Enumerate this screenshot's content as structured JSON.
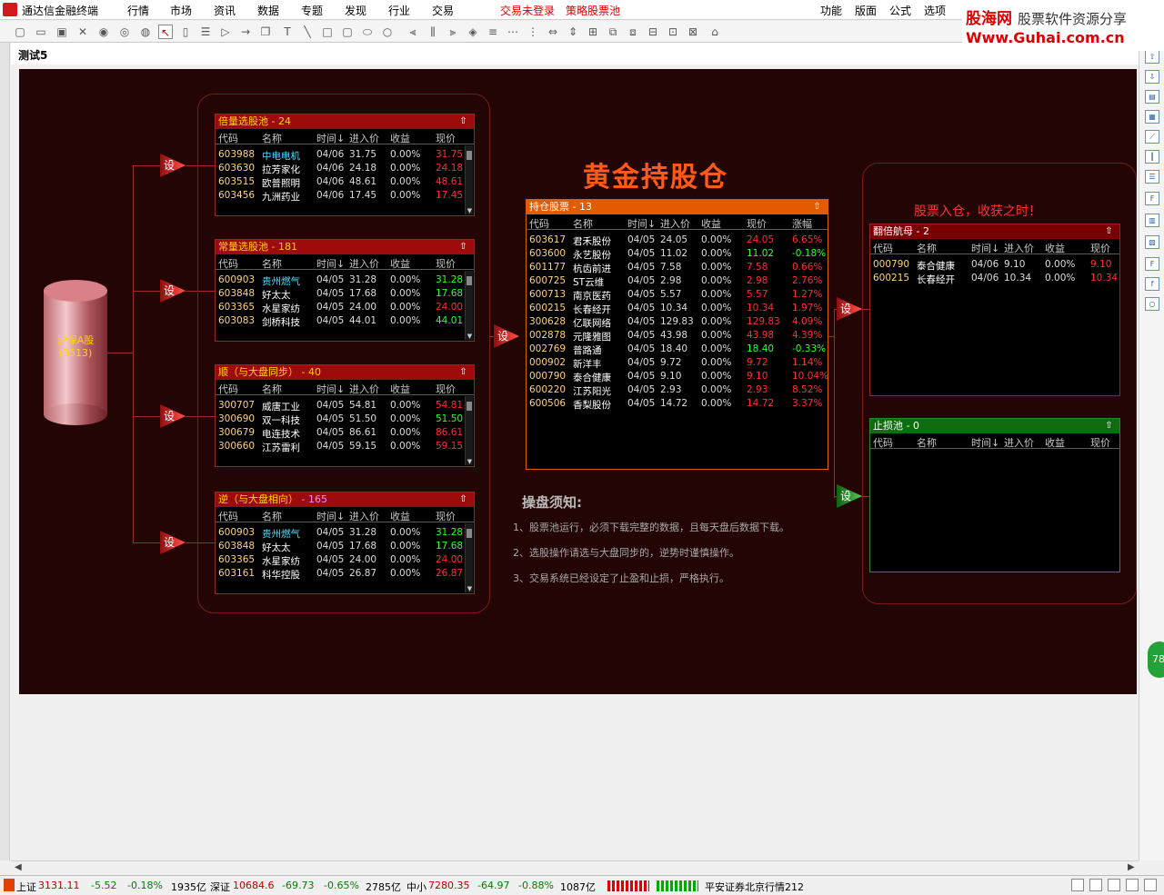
{
  "app": {
    "title": "通达信金融终端"
  },
  "menu": {
    "items": [
      "行情",
      "市场",
      "资讯",
      "数据",
      "专题",
      "发现",
      "行业",
      "交易"
    ],
    "login": "交易未登录",
    "strategy": "策略股票池",
    "right_items": [
      "功能",
      "版面",
      "公式",
      "选项"
    ]
  },
  "watermark": {
    "line1_brand": "股海网",
    "line1_tag": "股票软件资源分享",
    "line2": "Www.Guhai.com.cn"
  },
  "doc": {
    "title": "测试5"
  },
  "source": {
    "label": "沪深A股",
    "count": "(3513)"
  },
  "set_label": "设",
  "pools": [
    {
      "title": "倍量选股池",
      "count": "- 24",
      "headers": [
        "代码",
        "名称",
        "时间↓",
        "进入价",
        "收益",
        "现价"
      ],
      "rows": [
        {
          "code": "603988",
          "name": "中电电机",
          "time": "04/06",
          "entry": "31.75",
          "ret": "0.00%",
          "price": "31.75",
          "dir": "up",
          "cyan": true
        },
        {
          "code": "603630",
          "name": "拉芳家化",
          "time": "04/06",
          "entry": "24.18",
          "ret": "0.00%",
          "price": "24.18",
          "dir": "up",
          "cyan": false
        },
        {
          "code": "603515",
          "name": "欧普照明",
          "time": "04/06",
          "entry": "48.61",
          "ret": "0.00%",
          "price": "48.61",
          "dir": "up",
          "cyan": false
        },
        {
          "code": "603456",
          "name": "九洲药业",
          "time": "04/06",
          "entry": "17.45",
          "ret": "0.00%",
          "price": "17.45",
          "dir": "up",
          "cyan": false
        }
      ]
    },
    {
      "title": "常量选股池",
      "count": "- 181",
      "headers": [
        "代码",
        "名称",
        "时间↓",
        "进入价",
        "收益",
        "现价"
      ],
      "rows": [
        {
          "code": "600903",
          "name": "贵州燃气",
          "time": "04/05",
          "entry": "31.28",
          "ret": "0.00%",
          "price": "31.28",
          "dir": "dn",
          "cyan": true
        },
        {
          "code": "603848",
          "name": "好太太",
          "time": "04/05",
          "entry": "17.68",
          "ret": "0.00%",
          "price": "17.68",
          "dir": "dn",
          "cyan": false
        },
        {
          "code": "603365",
          "name": "水星家纺",
          "time": "04/05",
          "entry": "24.00",
          "ret": "0.00%",
          "price": "24.00",
          "dir": "up",
          "cyan": false
        },
        {
          "code": "603083",
          "name": "剑桥科技",
          "time": "04/05",
          "entry": "44.01",
          "ret": "0.00%",
          "price": "44.01",
          "dir": "dn",
          "cyan": false
        }
      ]
    },
    {
      "title": "顺（与大盘同步）",
      "count": "- 40",
      "headers": [
        "代码",
        "名称",
        "时间↓",
        "进入价",
        "收益",
        "现价"
      ],
      "rows": [
        {
          "code": "300707",
          "name": "威唐工业",
          "time": "04/05",
          "entry": "54.81",
          "ret": "0.00%",
          "price": "54.81",
          "dir": "up",
          "cyan": false
        },
        {
          "code": "300690",
          "name": "双一科技",
          "time": "04/05",
          "entry": "51.50",
          "ret": "0.00%",
          "price": "51.50",
          "dir": "dn",
          "cyan": false
        },
        {
          "code": "300679",
          "name": "电连技术",
          "time": "04/05",
          "entry": "86.61",
          "ret": "0.00%",
          "price": "86.61",
          "dir": "up",
          "cyan": false
        },
        {
          "code": "300660",
          "name": "江苏雷利",
          "time": "04/05",
          "entry": "59.15",
          "ret": "0.00%",
          "price": "59.15",
          "dir": "up",
          "cyan": false
        }
      ]
    },
    {
      "title": "逆（与大盘相向）",
      "count": "- 165",
      "headers": [
        "代码",
        "名称",
        "时间↓",
        "进入价",
        "收益",
        "现价"
      ],
      "rows": [
        {
          "code": "600903",
          "name": "贵州燃气",
          "time": "04/05",
          "entry": "31.28",
          "ret": "0.00%",
          "price": "31.28",
          "dir": "dn",
          "cyan": true
        },
        {
          "code": "603848",
          "name": "好太太",
          "time": "04/05",
          "entry": "17.68",
          "ret": "0.00%",
          "price": "17.68",
          "dir": "dn",
          "cyan": false
        },
        {
          "code": "603365",
          "name": "水星家纺",
          "time": "04/05",
          "entry": "24.00",
          "ret": "0.00%",
          "price": "24.00",
          "dir": "up",
          "cyan": false
        },
        {
          "code": "603161",
          "name": "科华控股",
          "time": "04/05",
          "entry": "26.87",
          "ret": "0.00%",
          "price": "26.87",
          "dir": "up",
          "cyan": false
        }
      ]
    }
  ],
  "holding": {
    "big_title": "黄金持股仓",
    "title": "持仓股票",
    "count": "- 13",
    "headers": [
      "代码",
      "名称",
      "时间↓",
      "进入价",
      "收益",
      "现价",
      "涨幅"
    ],
    "rows": [
      {
        "code": "603617",
        "name": "君禾股份",
        "time": "04/05",
        "entry": "24.05",
        "ret": "0.00%",
        "price": "24.05",
        "chg": "6.65%",
        "dir": "up"
      },
      {
        "code": "603600",
        "name": "永艺股份",
        "time": "04/05",
        "entry": "11.02",
        "ret": "0.00%",
        "price": "11.02",
        "chg": "-0.18%",
        "dir": "dn"
      },
      {
        "code": "601177",
        "name": "杭齿前进",
        "time": "04/05",
        "entry": "7.58",
        "ret": "0.00%",
        "price": "7.58",
        "chg": "0.66%",
        "dir": "up"
      },
      {
        "code": "600725",
        "name": "ST云维",
        "time": "04/05",
        "entry": "2.98",
        "ret": "0.00%",
        "price": "2.98",
        "chg": "2.76%",
        "dir": "up"
      },
      {
        "code": "600713",
        "name": "南京医药",
        "time": "04/05",
        "entry": "5.57",
        "ret": "0.00%",
        "price": "5.57",
        "chg": "1.27%",
        "dir": "up"
      },
      {
        "code": "600215",
        "name": "长春经开",
        "time": "04/05",
        "entry": "10.34",
        "ret": "0.00%",
        "price": "10.34",
        "chg": "1.97%",
        "dir": "up"
      },
      {
        "code": "300628",
        "name": "亿联网络",
        "time": "04/05",
        "entry": "129.83",
        "ret": "0.00%",
        "price": "129.83",
        "chg": "4.09%",
        "dir": "up"
      },
      {
        "code": "002878",
        "name": "元隆雅图",
        "time": "04/05",
        "entry": "43.98",
        "ret": "0.00%",
        "price": "43.98",
        "chg": "4.39%",
        "dir": "up"
      },
      {
        "code": "002769",
        "name": "普路通",
        "time": "04/05",
        "entry": "18.40",
        "ret": "0.00%",
        "price": "18.40",
        "chg": "-0.33%",
        "dir": "dn"
      },
      {
        "code": "000902",
        "name": "新洋丰",
        "time": "04/05",
        "entry": "9.72",
        "ret": "0.00%",
        "price": "9.72",
        "chg": "1.14%",
        "dir": "up"
      },
      {
        "code": "000790",
        "name": "泰合健康",
        "time": "04/05",
        "entry": "9.10",
        "ret": "0.00%",
        "price": "9.10",
        "chg": "10.04%",
        "dir": "up"
      },
      {
        "code": "600220",
        "name": "江苏阳光",
        "time": "04/05",
        "entry": "2.93",
        "ret": "0.00%",
        "price": "2.93",
        "chg": "8.52%",
        "dir": "up"
      },
      {
        "code": "600506",
        "name": "香梨股份",
        "time": "04/05",
        "entry": "14.72",
        "ret": "0.00%",
        "price": "14.72",
        "chg": "3.37%",
        "dir": "up"
      }
    ]
  },
  "notes": {
    "title": "操盘须知:",
    "items": [
      "1、股票池运行，必须下载完整的数据，且每天盘后数据下载。",
      "2、选股操作请选与大盘同步的，逆势时谨慎操作。",
      "3、交易系统已经设定了止盈和止损，严格执行。"
    ]
  },
  "right": {
    "slogan": "股票入仓，收获之时！",
    "tenbagger": {
      "title": "翻倍航母",
      "count": "- 2",
      "headers": [
        "代码",
        "名称",
        "时间↓",
        "进入价",
        "收益",
        "现价"
      ],
      "rows": [
        {
          "code": "000790",
          "name": "泰合健康",
          "time": "04/06",
          "entry": "9.10",
          "ret": "0.00%",
          "price": "9.10"
        },
        {
          "code": "600215",
          "name": "长春经开",
          "time": "04/06",
          "entry": "10.34",
          "ret": "0.00%",
          "price": "10.34"
        }
      ]
    },
    "stoploss": {
      "title": "止损池",
      "count": "- 0",
      "headers": [
        "代码",
        "名称",
        "时间↓",
        "进入价",
        "收益",
        "现价"
      ]
    }
  },
  "side_badge": "78",
  "status": {
    "sh_name": "上证",
    "sh_val": "3131.11",
    "sh_chg": "-5.52",
    "sh_pct": "-0.18%",
    "sh_amt": "1935亿",
    "sz_name": "深证",
    "sz_val": "10684.6",
    "sz_chg": "-69.73",
    "sz_pct": "-0.65%",
    "sz_amt": "2785亿",
    "zx_name": "中小",
    "zx_val": "7280.35",
    "zx_chg": "-64.97",
    "zx_pct": "-0.88%",
    "zx_amt": "1087亿",
    "broker": "平安证券北京行情212"
  },
  "colors": {
    "up": "#ff3030",
    "down": "#30ff30",
    "canvas": "#230505",
    "title_bar": "#9e0b0b"
  }
}
